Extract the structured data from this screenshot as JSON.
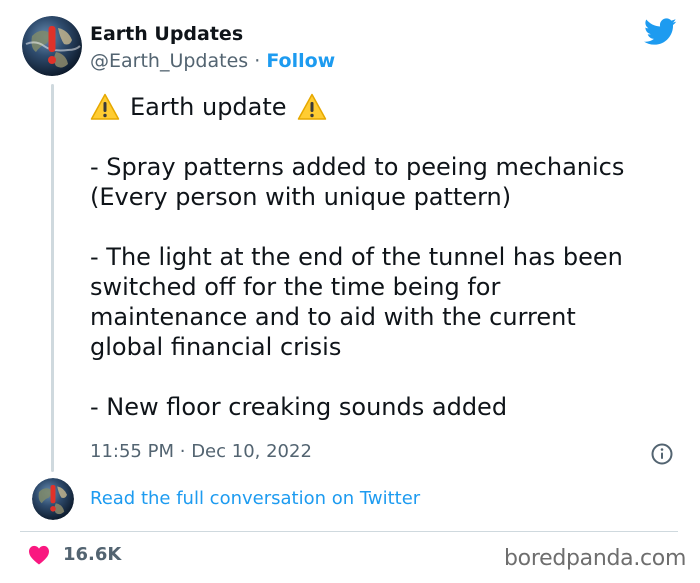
{
  "author": {
    "name": "Earth Updates",
    "handle": "@Earth_Updates",
    "separator": "·",
    "follow_label": "Follow"
  },
  "tweet": {
    "headline": "Earth update",
    "paragraphs": [
      "- Spray patterns added to peeing mechanics\n(Every person with unique pattern)",
      "- The light at the end of the tunnel has been\nswitched off for the time being for\nmaintenance and to aid with the current\nglobal financial crisis",
      "- New floor creaking sounds added"
    ],
    "time": "11:55 PM",
    "date_separator": "·",
    "date": "Dec 10, 2022"
  },
  "links": {
    "read_full": "Read the full conversation on Twitter"
  },
  "engagement": {
    "likes": "16.6K"
  },
  "watermark": "boredpanda.com",
  "icons": {
    "warning": "warning-icon",
    "twitter": "twitter-bird-icon",
    "info": "info-icon",
    "heart": "heart-icon"
  },
  "colors": {
    "accent": "#1d9bf0",
    "text": "#0f1419",
    "muted": "#536471",
    "heart": "#f91880",
    "warning": "#ffcc32"
  }
}
